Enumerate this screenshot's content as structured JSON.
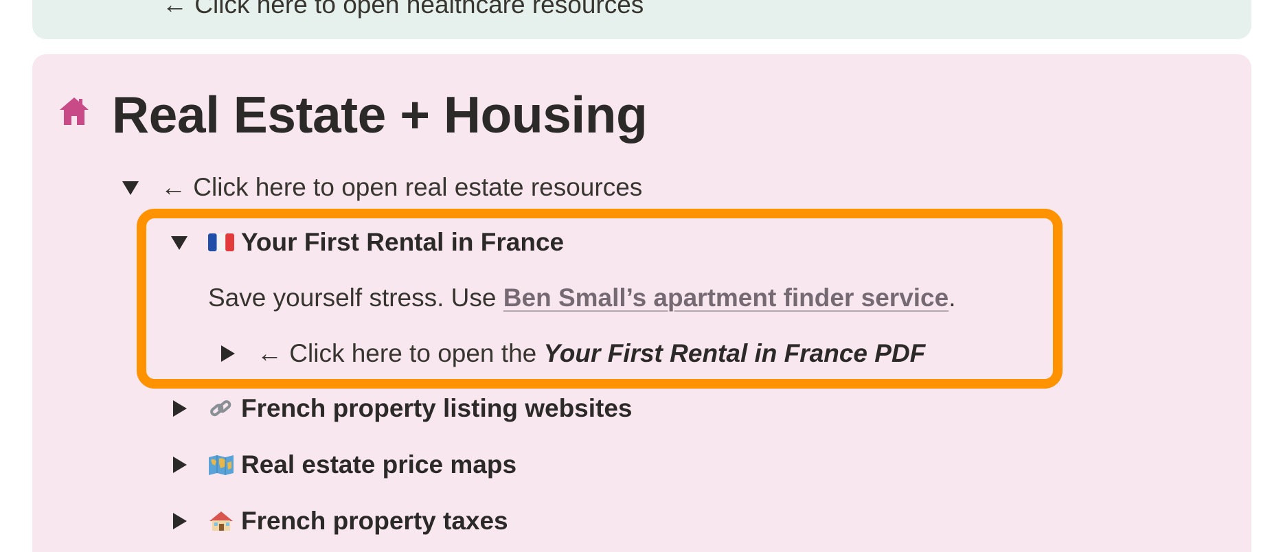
{
  "previous_callout": {
    "toggle_arrow": "←",
    "toggle_text": "Click here to open healthcare resources"
  },
  "section": {
    "icon": "house-icon",
    "title": "Real Estate + Housing",
    "color": "#c84b88",
    "toggle": {
      "arrow": "←",
      "label": "Click here to open real estate resources",
      "expanded": true
    },
    "items": [
      {
        "emoji": "france-flag-icon",
        "title": "Your First Rental in France",
        "expanded": true,
        "body_prefix": "Save yourself stress. Use ",
        "body_link": "Ben Small’s apartment finder service",
        "body_suffix": ".",
        "sub_toggle": {
          "arrow": "←",
          "prefix": "Click here to open the ",
          "emphasis": "Your First Rental in France PDF",
          "expanded": false
        }
      },
      {
        "emoji": "link-icon",
        "title": "French property listing websites",
        "expanded": false
      },
      {
        "emoji": "world-map-icon",
        "title": "Real estate price maps",
        "expanded": false
      },
      {
        "emoji": "house-emoji-icon",
        "title": "French property taxes",
        "expanded": false
      }
    ]
  },
  "highlight_color": "#ff9200"
}
